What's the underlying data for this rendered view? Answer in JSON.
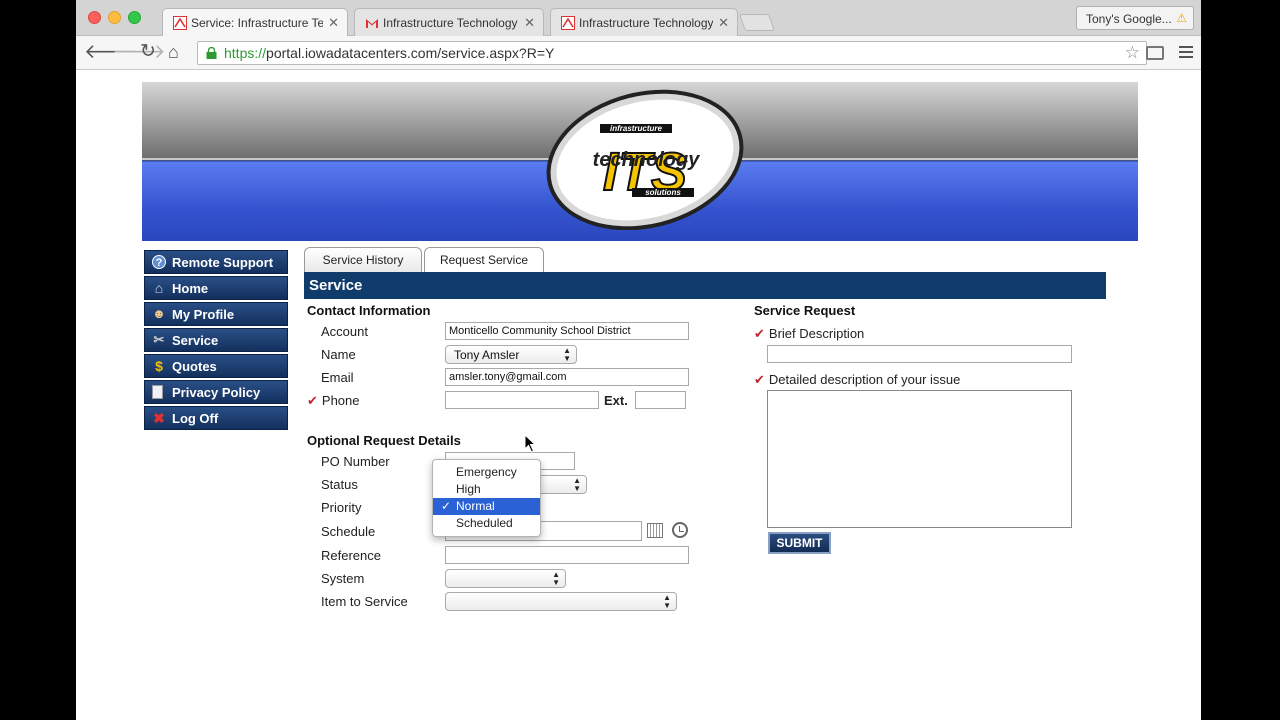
{
  "browser": {
    "tabs": [
      {
        "title": "Service: Infrastructure Tech",
        "active": true
      },
      {
        "title": "Infrastructure Technology S",
        "active": false
      },
      {
        "title": "Infrastructure Technology S",
        "active": false
      }
    ],
    "profile": "Tony's Google...",
    "url_scheme": "https://",
    "url_rest": "portal.iowadatacenters.com/service.aspx?R=Y"
  },
  "logo": {
    "top": "infrastructure",
    "middle": "technology",
    "mark": "ITS",
    "bottom": "solutions"
  },
  "sidebar": {
    "items": [
      {
        "label": "Remote Support",
        "icon": "remote-support-icon"
      },
      {
        "label": "Home",
        "icon": "home-icon"
      },
      {
        "label": "My Profile",
        "icon": "profile-icon"
      },
      {
        "label": "Service",
        "icon": "wrench-icon"
      },
      {
        "label": "Quotes",
        "icon": "dollar-icon"
      },
      {
        "label": "Privacy Policy",
        "icon": "document-icon"
      },
      {
        "label": "Log Off",
        "icon": "close-icon"
      }
    ]
  },
  "tabs": {
    "history": "Service History",
    "request": "Request Service"
  },
  "section_title": "Service",
  "contact": {
    "heading": "Contact Information",
    "account_label": "Account",
    "account_value": "Monticello Community School District",
    "name_label": "Name",
    "name_value": "Tony Amsler",
    "email_label": "Email",
    "email_value": "amsler.tony@gmail.com",
    "phone_label": "Phone",
    "ext_label": "Ext."
  },
  "optional": {
    "heading": "Optional Request Details",
    "po_label": "PO Number",
    "status_label": "Status",
    "priority_label": "Priority",
    "schedule_label": "Schedule",
    "reference_label": "Reference",
    "system_label": "System",
    "item_label": "Item to Service"
  },
  "priority_dropdown": {
    "options": [
      "Emergency",
      "High",
      "Normal",
      "Scheduled"
    ],
    "selected": "Normal"
  },
  "service_request": {
    "heading": "Service Request",
    "brief_label": "Brief Description",
    "detail_label": "Detailed description of your issue",
    "submit": "SUBMIT"
  },
  "colors": {
    "nav_blue": "#103c6b",
    "required": "#c0262d",
    "selection": "#2a62d6"
  }
}
